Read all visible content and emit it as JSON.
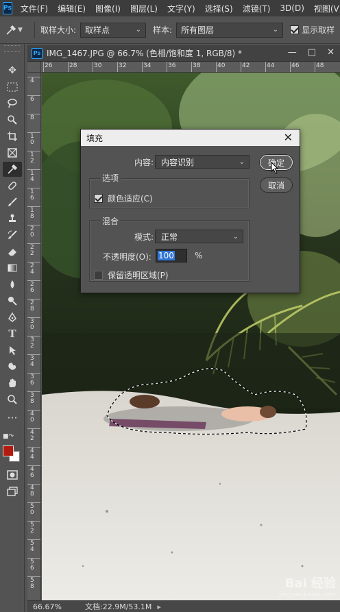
{
  "app": {
    "logo": "Ps"
  },
  "menubar": {
    "items": [
      "文件(F)",
      "编辑(E)",
      "图像(I)",
      "图层(L)",
      "文字(Y)",
      "选择(S)",
      "滤镜(T)",
      "3D(D)",
      "视图(V)"
    ]
  },
  "options": {
    "sample_size_label": "取样大小:",
    "sample_size_value": "取样点",
    "sample_label": "样本:",
    "sample_value": "所有图层",
    "show_ring_label": "显示取样",
    "show_ring_checked": true
  },
  "tools": [
    "move-tool",
    "marquee-tool",
    "lasso-tool",
    "quick-select-tool",
    "crop-tool",
    "frame-tool",
    "eyedropper-tool",
    "healing-tool",
    "brush-tool",
    "clone-stamp-tool",
    "history-brush-tool",
    "eraser-tool",
    "gradient-tool",
    "blur-tool",
    "dodge-tool",
    "pen-tool",
    "type-tool",
    "path-select-tool",
    "shape-tool",
    "hand-tool",
    "zoom-tool",
    "more-tools"
  ],
  "colors": {
    "foreground": "#b31a10",
    "background": "#ffffff",
    "accent": "#31a8ff"
  },
  "document": {
    "title": "IMG_1467.JPG @ 66.7% (色相/饱和度 1, RGB/8) *",
    "ruler_top": [
      "26",
      "28",
      "30",
      "32",
      "34",
      "36",
      "38",
      "40",
      "42",
      "44",
      "46",
      "48"
    ],
    "ruler_left": [
      "4",
      "6",
      "8",
      "10",
      "12",
      "14",
      "16",
      "18",
      "20",
      "22",
      "24",
      "26",
      "28",
      "30",
      "32",
      "34",
      "36",
      "38",
      "40",
      "42",
      "44",
      "46",
      "48",
      "50",
      "52",
      "54",
      "56",
      "58"
    ]
  },
  "status": {
    "zoom": "66.67%",
    "doc_info": "文档:22.9M/53.1M"
  },
  "dialog": {
    "title": "填充",
    "content_label": "内容:",
    "content_value": "内容识别",
    "options_group": "选项",
    "color_adapt_label": "颜色适应(C)",
    "color_adapt_checked": true,
    "blend_group": "混合",
    "mode_label": "模式:",
    "mode_value": "正常",
    "opacity_label": "不透明度(O):",
    "opacity_value": "100",
    "opacity_unit": "%",
    "preserve_label": "保留透明区域(P)",
    "preserve_checked": false,
    "ok_label": "确定",
    "cancel_label": "取消"
  },
  "watermark": {
    "main": "Bai 经验",
    "sub": "jingyan.baidu.com"
  }
}
